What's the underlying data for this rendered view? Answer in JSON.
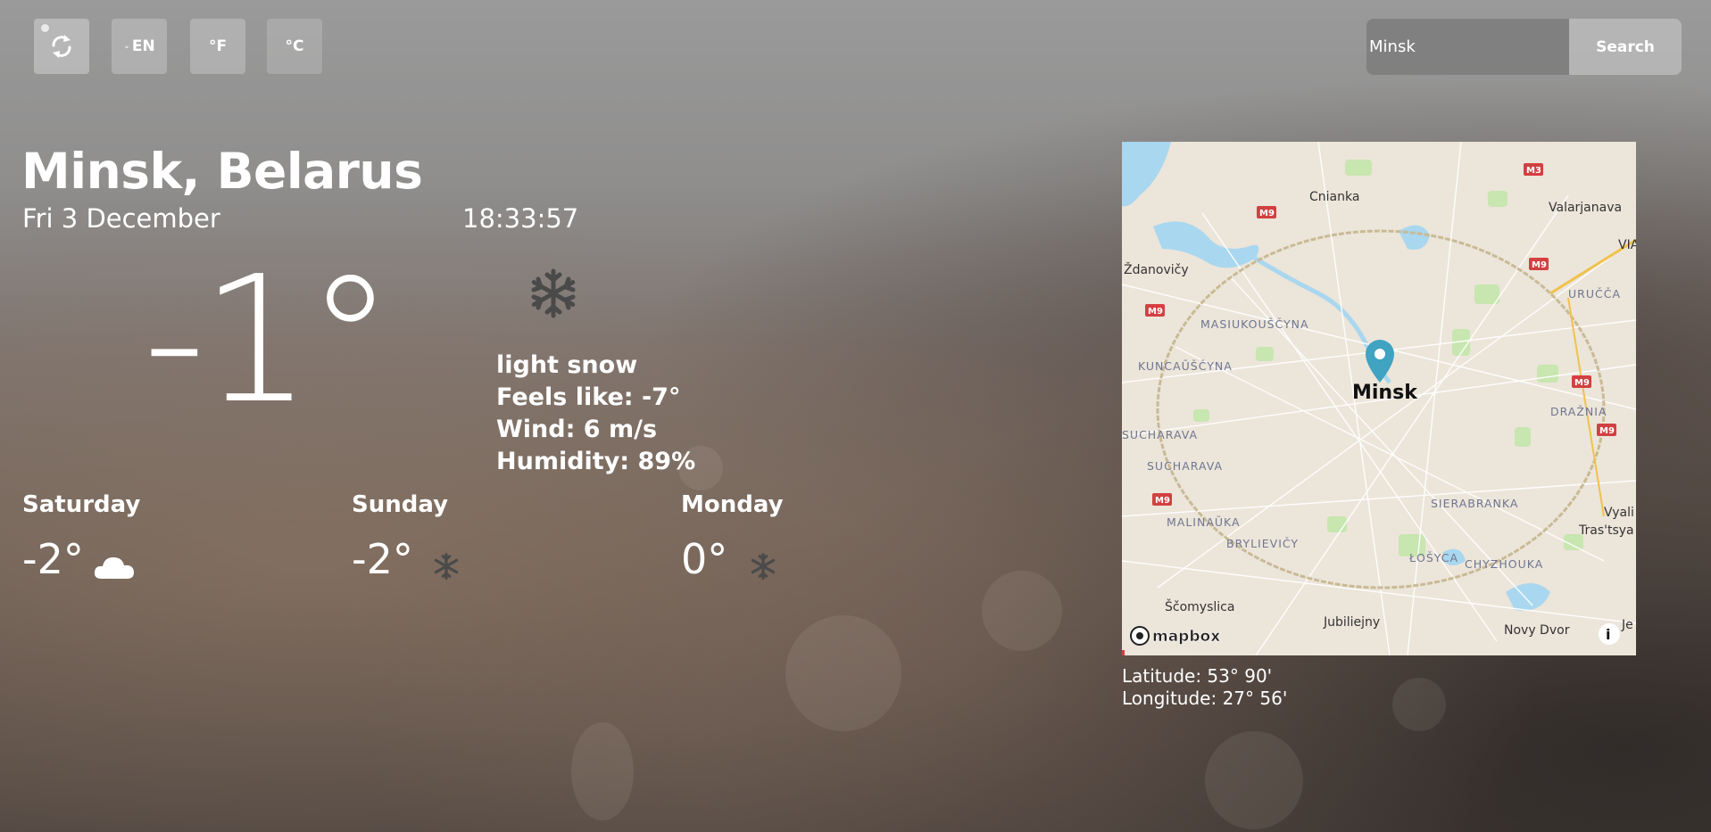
{
  "controls": {
    "lang_label": "EN",
    "fahrenheit_label": "°F",
    "celsius_label": "°C"
  },
  "search": {
    "value": "Minsk",
    "button_label": "Search"
  },
  "location": {
    "city": "Minsk, Belarus",
    "date": "Fri 3 December",
    "time": "18:33:57"
  },
  "current": {
    "temperature": "-1°",
    "icon": "snowflake-icon",
    "description": "light snow",
    "feels_like": "Feels like: -7°",
    "wind": "Wind: 6 m/s",
    "humidity": "Humidity: 89%"
  },
  "forecast": [
    {
      "day": "Saturday",
      "temp": "-2°",
      "icon": "cloud-icon"
    },
    {
      "day": "Sunday",
      "temp": "-2°",
      "icon": "snowflake-icon"
    },
    {
      "day": "Monday",
      "temp": "0°",
      "icon": "snowflake-icon"
    }
  ],
  "map": {
    "marker_label": "Minsk",
    "attribution": "mapbox",
    "places": [
      "Cnianka",
      "Valarjanava",
      "Ždanovičy",
      "MASIUKOUŠČYNA",
      "KUNCAŪŠČYNA",
      "URUČČA",
      "DRAŽNIA",
      "SUCHARAVA",
      "SUCHARAVA",
      "MALINAŪKA",
      "BRYLIEVIČY",
      "SIERABRANKA",
      "ŁOŠYCA",
      "CHYZHOUKA",
      "Ščomyslica",
      "Jubiliejny",
      "Novy Dvor",
      "Vyali",
      "Tras'tsya",
      "VIA",
      "Je"
    ],
    "road_labels": [
      "M3",
      "M9",
      "M9",
      "M9",
      "M9",
      "M9",
      "M9"
    ],
    "colors": {
      "water": "#a9d7ef",
      "park": "#c8e6b0",
      "land": "#ece5da",
      "road": "#ffffff",
      "ring": "#c9ba95",
      "marker": "#3fa3c1"
    }
  },
  "coordinates": {
    "latitude": "Latitude: 53° 90'",
    "longitude": "Longitude: 27° 56'"
  }
}
